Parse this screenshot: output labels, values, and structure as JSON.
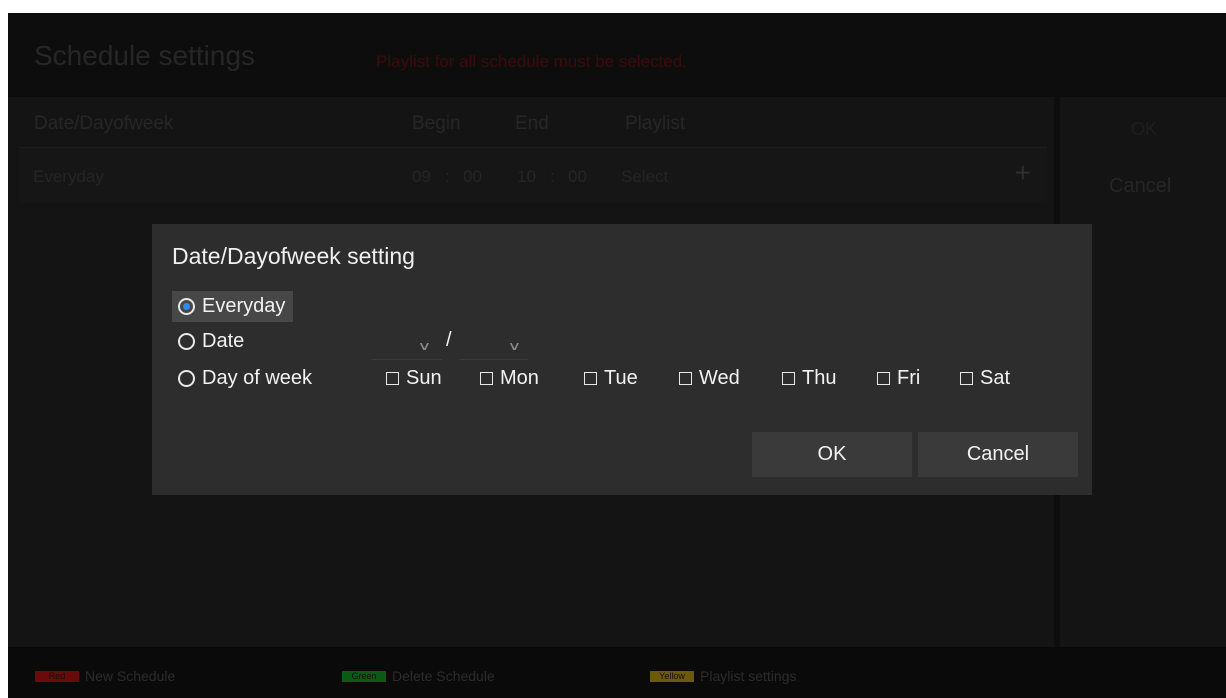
{
  "header": {
    "title": "Schedule settings",
    "warning": "Playlist for all schedule must be selected."
  },
  "table": {
    "columns": [
      "Date/Dayofweek",
      "Begin",
      "End",
      "Playlist"
    ],
    "rows": [
      {
        "date": "Everyday",
        "begin_h": "09",
        "begin_m": "00",
        "end_h": "10",
        "end_m": "00",
        "playlist": "Select",
        "sep": ":"
      }
    ],
    "add_icon": "plus-icon"
  },
  "side": {
    "ok_label": "OK",
    "cancel_label": "Cancel"
  },
  "footer": {
    "keys": [
      {
        "key": "Red",
        "label": "New Schedule",
        "color": "#6b0a0a"
      },
      {
        "key": "Green",
        "label": "Delete Schedule",
        "color": "#0a5a14"
      },
      {
        "key": "Yellow",
        "label": "Playlist settings",
        "color": "#6b5a0a"
      }
    ]
  },
  "dialog": {
    "title": "Date/Dayofweek setting",
    "options": [
      {
        "label": "Everyday",
        "selected": true
      },
      {
        "label": "Date",
        "selected": false
      },
      {
        "label": "Day of week",
        "selected": false
      }
    ],
    "date_separator": "/",
    "days": [
      "Sun",
      "Mon",
      "Tue",
      "Wed",
      "Thu",
      "Fri",
      "Sat"
    ],
    "ok_label": "OK",
    "cancel_label": "Cancel",
    "accent_color": "#2f8bf0"
  }
}
